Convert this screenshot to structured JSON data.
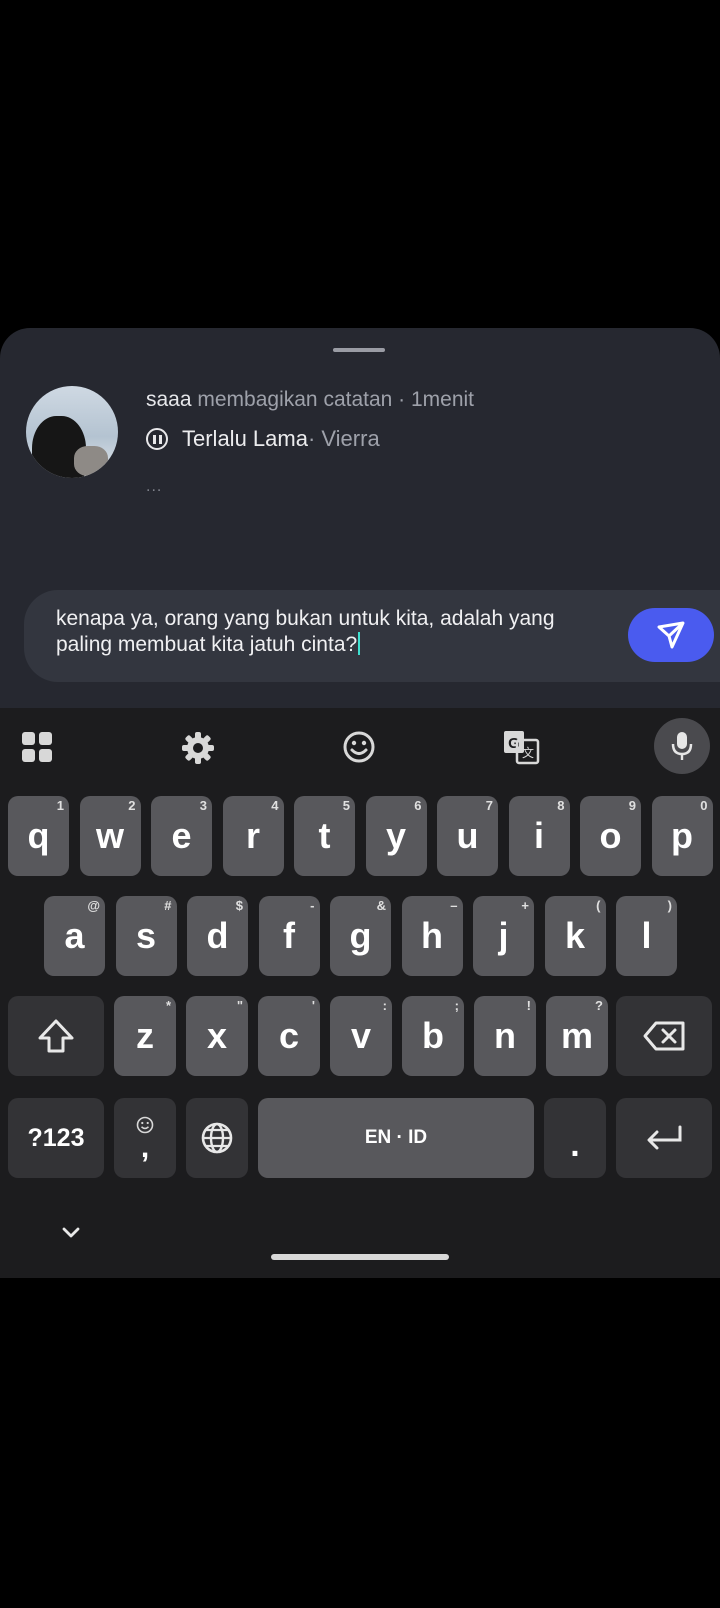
{
  "post": {
    "username": "saaa",
    "action": " membagikan catatan · 1menit",
    "song_title": "Terlalu Lama",
    "song_artist": " · Vierra",
    "more": "...",
    "icons": {
      "song_state": "pause-icon"
    }
  },
  "reply": {
    "text": "kenapa ya, orang yang bukan untuk kita, adalah yang paling membuat kita jatuh cinta?",
    "send_icon": "send-icon",
    "send_color": "#4a5bef"
  },
  "keyboard": {
    "toolbar": [
      "apps-grid-icon",
      "settings-gear-icon",
      "emoji-icon",
      "translate-icon",
      "mic-icon"
    ],
    "row1": [
      {
        "k": "q",
        "h": "1"
      },
      {
        "k": "w",
        "h": "2"
      },
      {
        "k": "e",
        "h": "3"
      },
      {
        "k": "r",
        "h": "4"
      },
      {
        "k": "t",
        "h": "5"
      },
      {
        "k": "y",
        "h": "6"
      },
      {
        "k": "u",
        "h": "7"
      },
      {
        "k": "i",
        "h": "8"
      },
      {
        "k": "o",
        "h": "9"
      },
      {
        "k": "p",
        "h": "0"
      }
    ],
    "row2": [
      {
        "k": "a",
        "h": "@"
      },
      {
        "k": "s",
        "h": "#"
      },
      {
        "k": "d",
        "h": "$"
      },
      {
        "k": "f",
        "h": "-"
      },
      {
        "k": "g",
        "h": "&"
      },
      {
        "k": "h",
        "h": "–"
      },
      {
        "k": "j",
        "h": "+"
      },
      {
        "k": "k",
        "h": "("
      },
      {
        "k": "l",
        "h": ")"
      }
    ],
    "row3": [
      {
        "k": "z",
        "h": "*"
      },
      {
        "k": "x",
        "h": "\""
      },
      {
        "k": "c",
        "h": "'"
      },
      {
        "k": "v",
        "h": ":"
      },
      {
        "k": "b",
        "h": ";"
      },
      {
        "k": "n",
        "h": "!"
      },
      {
        "k": "m",
        "h": "?"
      }
    ],
    "symbols_label": "?123",
    "comma_label": ",",
    "space_label": "EN · ID",
    "period_label": ".",
    "colors": {
      "key": "#58585c",
      "function_key": "#333336",
      "background": "#1c1c1e"
    }
  }
}
